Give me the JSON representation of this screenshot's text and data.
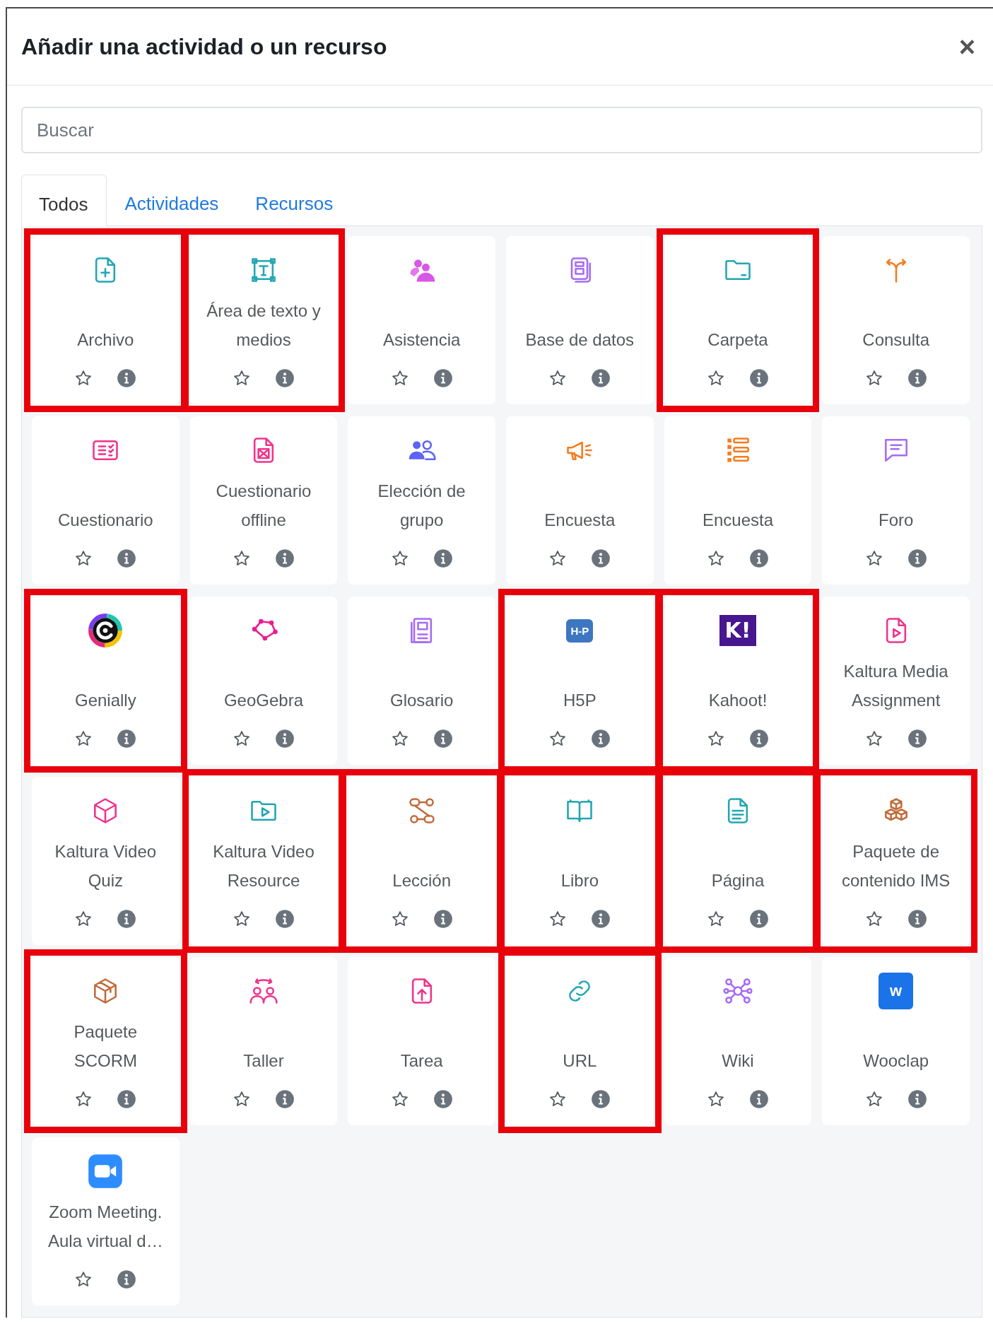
{
  "dialog": {
    "title": "Añadir una actividad o un recurso",
    "close": "×"
  },
  "search": {
    "placeholder": "Buscar"
  },
  "tabs": [
    {
      "label": "Todos",
      "selected": true
    },
    {
      "label": "Actividades",
      "selected": false
    },
    {
      "label": "Recursos",
      "selected": false
    }
  ],
  "items": [
    {
      "name": "Archivo",
      "color": "#22a6b3",
      "highlighted": true,
      "starred": false
    },
    {
      "name": "Área de texto y medios",
      "color": "#22a6b3",
      "highlighted": true,
      "starred": false
    },
    {
      "name": "Asistencia",
      "color": "#d957e6",
      "highlighted": false,
      "starred": false
    },
    {
      "name": "Base de datos",
      "color": "#a66bf5",
      "highlighted": false,
      "starred": false
    },
    {
      "name": "Carpeta",
      "color": "#22a6b3",
      "highlighted": true,
      "starred": false
    },
    {
      "name": "Consulta",
      "color": "#f57c20",
      "highlighted": false,
      "starred": false
    },
    {
      "name": "Cuestionario",
      "color": "#f0338c",
      "highlighted": false,
      "starred": false
    },
    {
      "name": "Cuestionario offline",
      "color": "#f0338c",
      "highlighted": false,
      "starred": false
    },
    {
      "name": "Elección de grupo",
      "color": "#5d63f6",
      "highlighted": false,
      "starred": false
    },
    {
      "name": "Encuesta",
      "color": "#f57c20",
      "highlighted": false,
      "starred": false
    },
    {
      "name": "Encuesta",
      "color": "#f57c20",
      "highlighted": false,
      "starred": false
    },
    {
      "name": "Foro",
      "color": "#a66bf5",
      "highlighted": false,
      "starred": false
    },
    {
      "name": "Genially",
      "highlighted": true,
      "starred": false
    },
    {
      "name": "GeoGebra",
      "color": "#e91e8c",
      "highlighted": false,
      "starred": false
    },
    {
      "name": "Glosario",
      "color": "#a66bf5",
      "highlighted": false,
      "starred": false
    },
    {
      "name": "H5P",
      "color": "#3d77c2",
      "badge_text": "H-P",
      "highlighted": true,
      "starred": false
    },
    {
      "name": "Kahoot!",
      "color": "#46178f",
      "badge_text": "K!",
      "highlighted": true,
      "starred": false
    },
    {
      "name": "Kaltura Media Assignment",
      "color": "#f0338c",
      "highlighted": false,
      "starred": false
    },
    {
      "name": "Kaltura Video Quiz",
      "color": "#f0338c",
      "highlighted": false,
      "starred": false
    },
    {
      "name": "Kaltura Video Resource",
      "color": "#22a6b3",
      "highlighted": true,
      "starred": false
    },
    {
      "name": "Lección",
      "color": "#c06b3a",
      "highlighted": true,
      "starred": false
    },
    {
      "name": "Libro",
      "color": "#22a6b3",
      "highlighted": true,
      "starred": false
    },
    {
      "name": "Página",
      "color": "#22a6b3",
      "highlighted": true,
      "starred": false
    },
    {
      "name": "Paquete de contenido IMS",
      "color": "#c06b3a",
      "highlighted": true,
      "starred": false
    },
    {
      "name": "Paquete SCORM",
      "color": "#c06b3a",
      "highlighted": true,
      "starred": false
    },
    {
      "name": "Taller",
      "color": "#f0338c",
      "highlighted": false,
      "starred": false
    },
    {
      "name": "Tarea",
      "color": "#f0338c",
      "highlighted": false,
      "starred": false
    },
    {
      "name": "URL",
      "color": "#22a6b3",
      "highlighted": true,
      "starred": false
    },
    {
      "name": "Wiki",
      "color": "#a66bf5",
      "highlighted": false,
      "starred": false
    },
    {
      "name": "Wooclap",
      "color": "#1a73e8",
      "badge_text": "w",
      "highlighted": false,
      "starred": false
    },
    {
      "name": "Zoom Meeting. Aula virtual d…",
      "color": "#2d8cff",
      "highlighted": false,
      "starred": false
    }
  ]
}
